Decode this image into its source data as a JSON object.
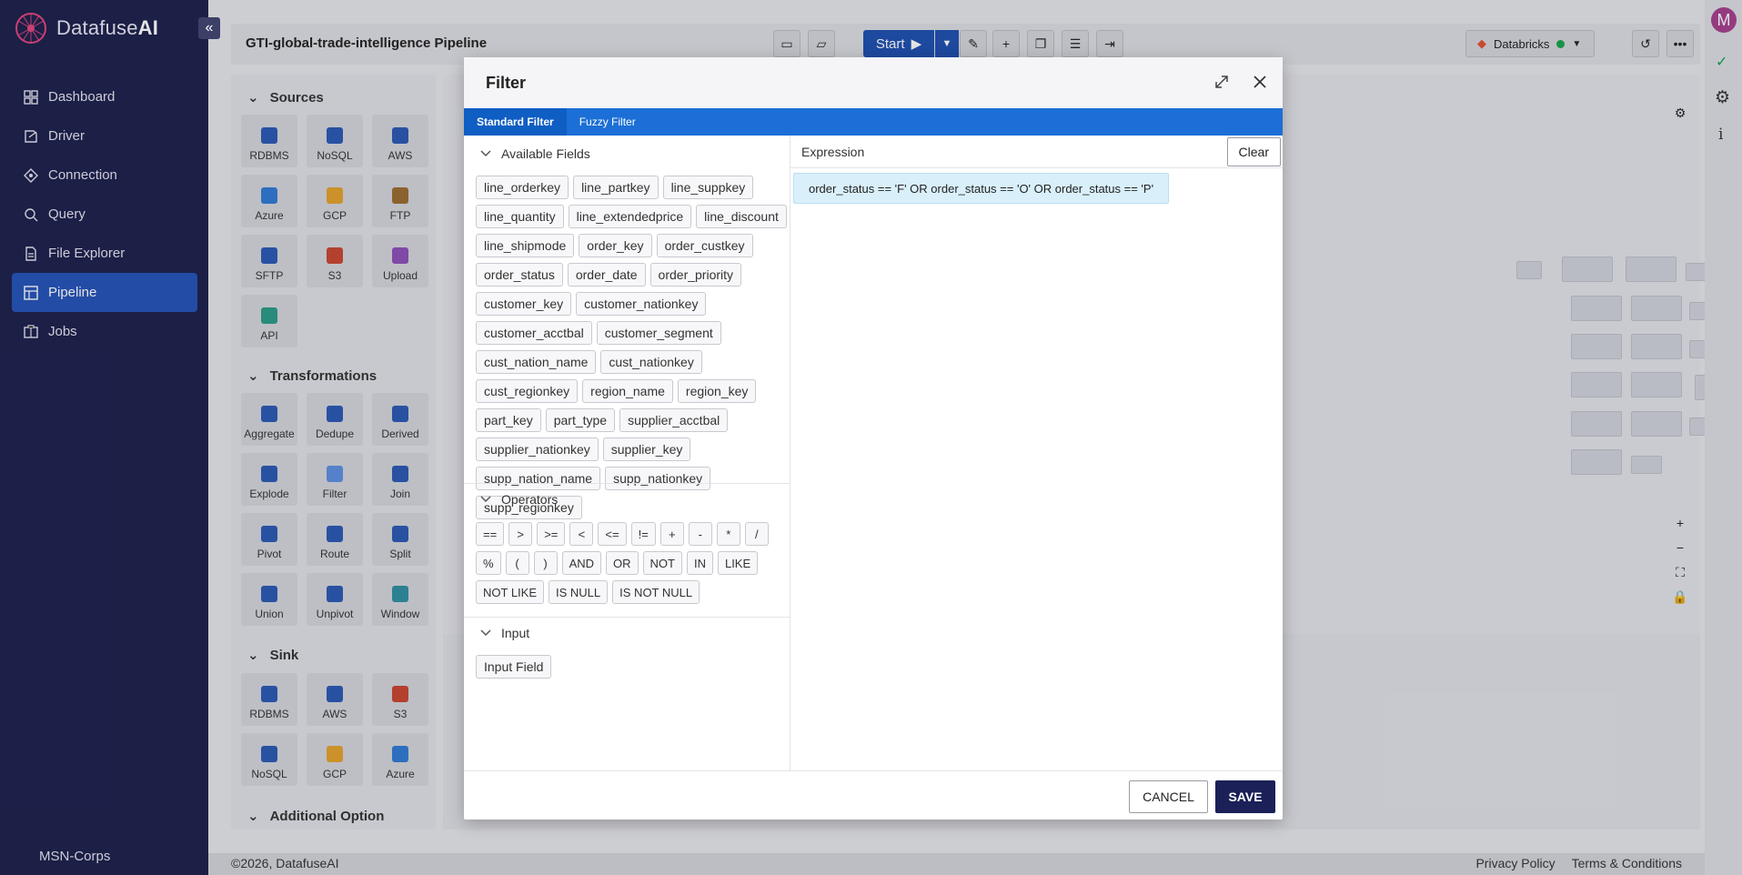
{
  "app": {
    "logo_text_a": "Datafuse",
    "logo_text_b": "AI",
    "collapse_label": "«",
    "org_name": "MSN-Corps",
    "avatar_initial": "M"
  },
  "nav": {
    "items": [
      {
        "label": "Dashboard",
        "icon": "grid-icon"
      },
      {
        "label": "Driver",
        "icon": "driver-icon"
      },
      {
        "label": "Connection",
        "icon": "connection-icon"
      },
      {
        "label": "Query",
        "icon": "query-icon"
      },
      {
        "label": "File Explorer",
        "icon": "file-icon"
      },
      {
        "label": "Pipeline",
        "icon": "pipeline-icon",
        "active": true
      },
      {
        "label": "Jobs",
        "icon": "jobs-icon"
      }
    ]
  },
  "header": {
    "pipeline_title": "GTI-global-trade-intelligence Pipeline",
    "start_label": "Start",
    "engine_label": "Databricks"
  },
  "left_panel": {
    "sections": [
      {
        "title": "Sources",
        "items": [
          "RDBMS",
          "NoSQL",
          "AWS",
          "Azure",
          "GCP",
          "FTP",
          "SFTP",
          "S3",
          "Upload",
          "API"
        ]
      },
      {
        "title": "Transformations",
        "items": [
          "Aggregate",
          "Dedupe",
          "Derived",
          "Explode",
          "Filter",
          "Join",
          "Pivot",
          "Route",
          "Split",
          "Union",
          "Unpivot",
          "Window"
        ]
      },
      {
        "title": "Sink",
        "items": [
          "RDBMS",
          "AWS",
          "S3",
          "NoSQL",
          "GCP",
          "Azure"
        ]
      },
      {
        "title": "Additional Option",
        "items": []
      }
    ]
  },
  "footer": {
    "copyright": "©2026, DatafuseAI",
    "privacy": "Privacy Policy",
    "terms": "Terms & Conditions"
  },
  "modal": {
    "title": "Filter",
    "tabs": [
      {
        "label": "Standard Filter",
        "active": true
      },
      {
        "label": "Fuzzy Filter",
        "active": false
      }
    ],
    "available_fields_title": "Available Fields",
    "fields": [
      "line_orderkey",
      "line_partkey",
      "line_suppkey",
      "line_quantity",
      "line_extendedprice",
      "line_discount",
      "line_shipmode",
      "order_key",
      "order_custkey",
      "order_status",
      "order_date",
      "order_priority",
      "customer_key",
      "customer_nationkey",
      "customer_acctbal",
      "customer_segment",
      "cust_nation_name",
      "cust_nationkey",
      "cust_regionkey",
      "region_name",
      "region_key",
      "part_key",
      "part_type",
      "supplier_acctbal",
      "supplier_nationkey",
      "supplier_key",
      "supp_nation_name",
      "supp_nationkey",
      "supp_regionkey"
    ],
    "operators_title": "Operators",
    "operators": [
      "==",
      ">",
      ">=",
      "<",
      "<=",
      "!=",
      "+",
      "-",
      "*",
      "/",
      "%",
      "(",
      ")",
      "AND",
      "OR",
      "NOT",
      "IN",
      "LIKE",
      "NOT LIKE",
      "IS NULL",
      "IS NOT NULL"
    ],
    "input_title": "Input",
    "input_field_label": "Input Field",
    "expression_label": "Expression",
    "clear_label": "Clear",
    "expression_value": "order_status == 'F' OR order_status == 'O' OR order_status == 'P'",
    "cancel_label": "CANCEL",
    "save_label": "SAVE"
  }
}
